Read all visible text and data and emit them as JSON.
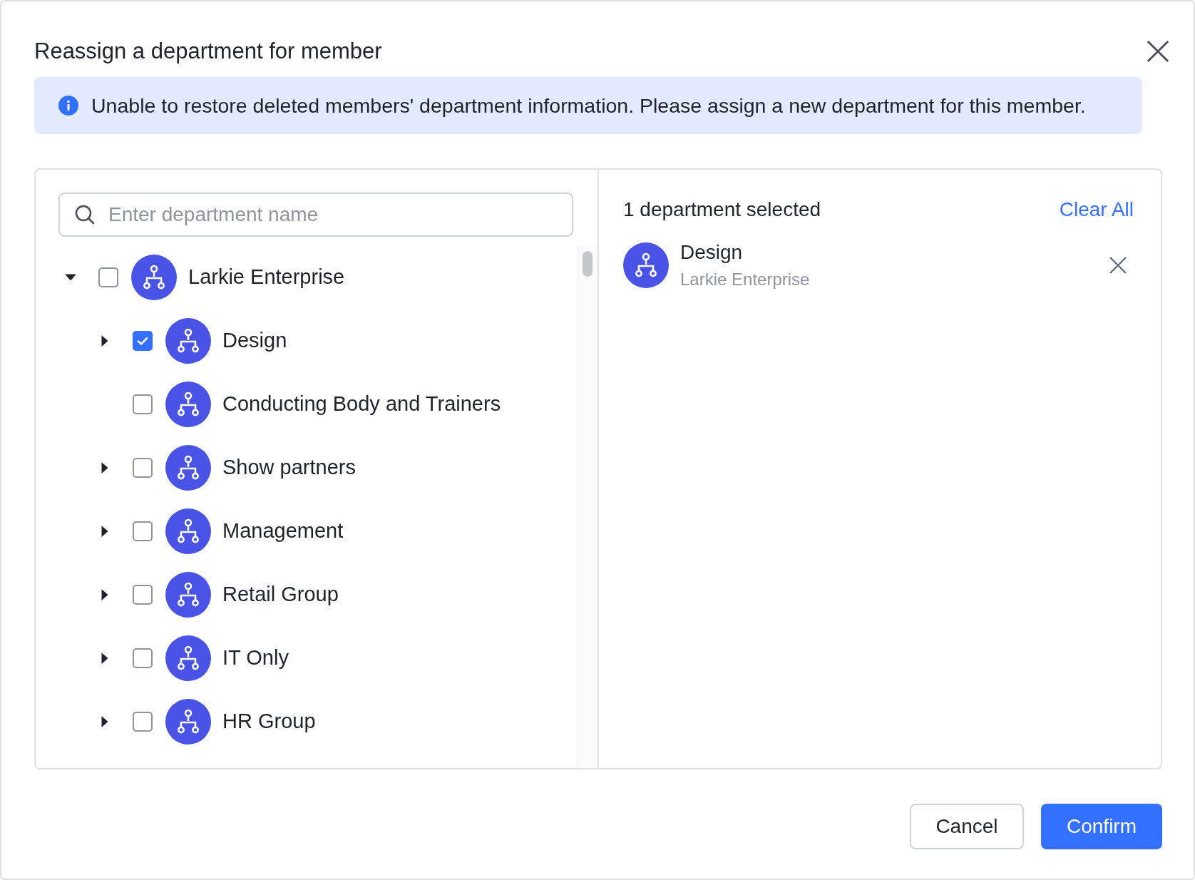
{
  "dialog": {
    "title": "Reassign a department for member"
  },
  "notice": {
    "text": "Unable to restore deleted members' department information. Please assign a new department for this member."
  },
  "search": {
    "placeholder": "Enter department name"
  },
  "tree": [
    {
      "label": "Larkie Enterprise",
      "expandable": true,
      "expanded": true,
      "checked": false,
      "children": [
        {
          "label": "Design",
          "expandable": true,
          "expanded": false,
          "checked": true
        },
        {
          "label": "Conducting Body and Trainers",
          "expandable": false,
          "checked": false
        },
        {
          "label": "Show partners",
          "expandable": true,
          "expanded": false,
          "checked": false
        },
        {
          "label": "Management",
          "expandable": true,
          "expanded": false,
          "checked": false
        },
        {
          "label": "Retail Group",
          "expandable": true,
          "expanded": false,
          "checked": false
        },
        {
          "label": "IT Only",
          "expandable": true,
          "expanded": false,
          "checked": false
        },
        {
          "label": "HR Group",
          "expandable": true,
          "expanded": false,
          "checked": false
        }
      ]
    }
  ],
  "selection": {
    "summary": "1 department selected",
    "clear_label": "Clear All",
    "items": [
      {
        "name": "Design",
        "parent": "Larkie Enterprise"
      }
    ]
  },
  "buttons": [
    {
      "label": "Cancel",
      "kind": "secondary"
    },
    {
      "label": "Confirm",
      "kind": "primary"
    }
  ]
}
